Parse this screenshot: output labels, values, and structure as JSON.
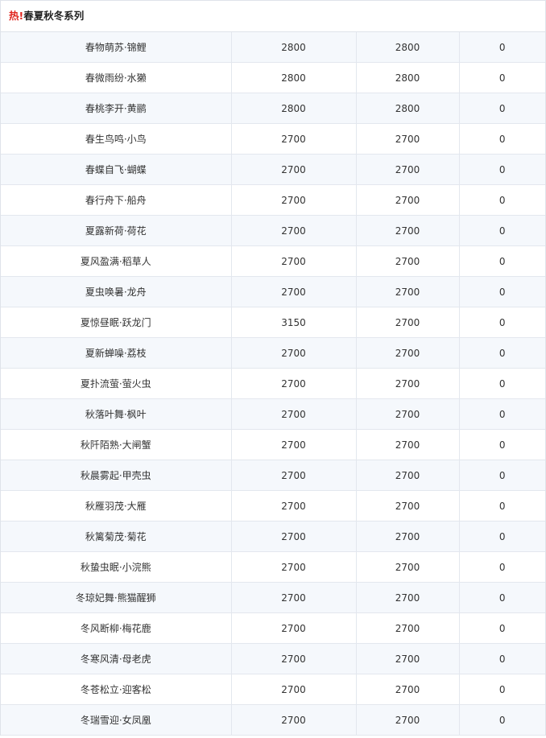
{
  "header": {
    "hot_mark": "热!",
    "title": "春夏秋冬系列"
  },
  "rows": [
    [
      "春物萌苏·锦鲤",
      "2800",
      "2800",
      "0"
    ],
    [
      "春微雨纷·水獭",
      "2800",
      "2800",
      "0"
    ],
    [
      "春桃李开·黄鹂",
      "2800",
      "2800",
      "0"
    ],
    [
      "春生鸟鸣·小鸟",
      "2700",
      "2700",
      "0"
    ],
    [
      "春蝶自飞·蝴蝶",
      "2700",
      "2700",
      "0"
    ],
    [
      "春行舟下·船舟",
      "2700",
      "2700",
      "0"
    ],
    [
      "夏露新荷·荷花",
      "2700",
      "2700",
      "0"
    ],
    [
      "夏风盈满·稻草人",
      "2700",
      "2700",
      "0"
    ],
    [
      "夏虫唤暑·龙舟",
      "2700",
      "2700",
      "0"
    ],
    [
      "夏惊昼眠·跃龙门",
      "3150",
      "2700",
      "0"
    ],
    [
      "夏新蝉噪·荔枝",
      "2700",
      "2700",
      "0"
    ],
    [
      "夏扑流萤·萤火虫",
      "2700",
      "2700",
      "0"
    ],
    [
      "秋落叶舞·枫叶",
      "2700",
      "2700",
      "0"
    ],
    [
      "秋阡陌熟·大闸蟹",
      "2700",
      "2700",
      "0"
    ],
    [
      "秋晨雾起·甲壳虫",
      "2700",
      "2700",
      "0"
    ],
    [
      "秋雁羽茂·大雁",
      "2700",
      "2700",
      "0"
    ],
    [
      "秋篱菊茂·菊花",
      "2700",
      "2700",
      "0"
    ],
    [
      "秋蛰虫眠·小浣熊",
      "2700",
      "2700",
      "0"
    ],
    [
      "冬琼妃舞·熊猫醒狮",
      "2700",
      "2700",
      "0"
    ],
    [
      "冬风断柳·梅花鹿",
      "2700",
      "2700",
      "0"
    ],
    [
      "冬寒风清·母老虎",
      "2700",
      "2700",
      "0"
    ],
    [
      "冬苍松立·迎客松",
      "2700",
      "2700",
      "0"
    ],
    [
      "冬瑞雪迎·女凤凰",
      "2700",
      "2700",
      "0"
    ]
  ]
}
